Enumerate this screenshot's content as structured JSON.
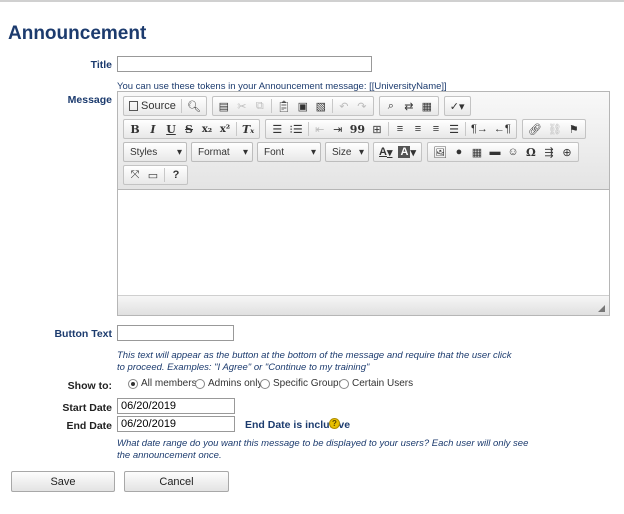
{
  "page": {
    "title": "Announcement"
  },
  "title_field": {
    "label": "Title",
    "value": ""
  },
  "message": {
    "label": "Message",
    "token_hint": "You can use these tokens in your Announcement message: [[UniversityName]]",
    "toolbar": {
      "source_label": "Source",
      "bold": "B",
      "italic": "I",
      "underline": "U",
      "strike": "S",
      "subscript": "x₂",
      "superscript": "x²",
      "remove_format": "Tₓ",
      "blockquote": "99",
      "styles": "Styles",
      "format": "Format",
      "font": "Font",
      "size": "Size",
      "text_color": "A",
      "bg_color": "A",
      "omega": "Ω",
      "help": "?"
    },
    "body": ""
  },
  "button_text": {
    "label": "Button Text",
    "value": "",
    "hint_line1": "This text will appear as the button at the bottom of the message and require that the user click",
    "hint_line2": "to proceed. Examples: \"I Agree\" or \"Continue to my training\""
  },
  "show_to": {
    "label": "Show to:",
    "options": [
      "All members",
      "Admins only",
      "Specific Groups",
      "Certain Users"
    ],
    "selected": "All members"
  },
  "start_date": {
    "label": "Start Date",
    "value": "06/20/2019"
  },
  "end_date": {
    "label": "End Date",
    "value": "06/20/2019",
    "inclusive_note": "End Date is inclusive",
    "help_symbol": "?"
  },
  "date_hint_line1": "What date range do you want this message to be displayed to your users? Each user will only see",
  "date_hint_line2": "the announcement once.",
  "actions": {
    "save": "Save",
    "cancel": "Cancel"
  }
}
